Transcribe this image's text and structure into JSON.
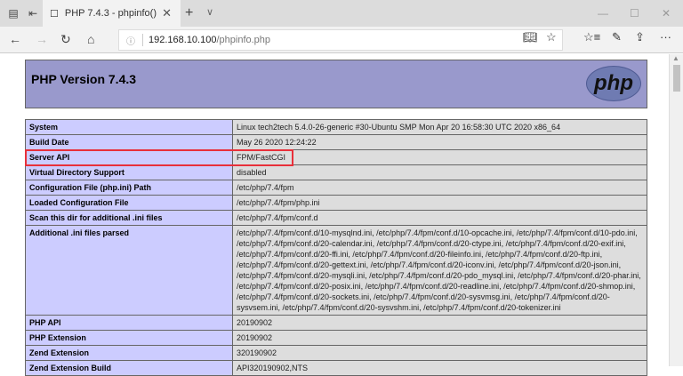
{
  "browser": {
    "tab_title": "PHP 7.4.3 - phpinfo()",
    "url_host": "192.168.10.100",
    "url_path": "/phpinfo.php",
    "icons": [
      "tab-set-aside-icon",
      "tab-preview-icon",
      "page-icon",
      "close-icon",
      "plus-icon",
      "chevron-down-icon",
      "minimize-icon",
      "maximize-icon",
      "window-close-icon",
      "back-icon",
      "forward-icon",
      "refresh-icon",
      "home-icon",
      "info-icon",
      "reading-view-icon",
      "star-icon",
      "favorites-icon",
      "pen-icon",
      "share-icon",
      "more-icon"
    ]
  },
  "page": {
    "title": "PHP Version 7.4.3",
    "logo_text": "php",
    "rows": [
      {
        "label": "System",
        "value": "Linux tech2tech 5.4.0-26-generic #30-Ubuntu SMP Mon Apr 20 16:58:30 UTC 2020 x86_64"
      },
      {
        "label": "Build Date",
        "value": "May 26 2020 12:24:22"
      },
      {
        "label": "Server API",
        "value": "FPM/FastCGI"
      },
      {
        "label": "Virtual Directory Support",
        "value": "disabled"
      },
      {
        "label": "Configuration File (php.ini) Path",
        "value": "/etc/php/7.4/fpm"
      },
      {
        "label": "Loaded Configuration File",
        "value": "/etc/php/7.4/fpm/php.ini"
      },
      {
        "label": "Scan this dir for additional .ini files",
        "value": "/etc/php/7.4/fpm/conf.d"
      },
      {
        "label": "Additional .ini files parsed",
        "value": "/etc/php/7.4/fpm/conf.d/10-mysqlnd.ini, /etc/php/7.4/fpm/conf.d/10-opcache.ini, /etc/php/7.4/fpm/conf.d/10-pdo.ini, /etc/php/7.4/fpm/conf.d/20-calendar.ini, /etc/php/7.4/fpm/conf.d/20-ctype.ini, /etc/php/7.4/fpm/conf.d/20-exif.ini, /etc/php/7.4/fpm/conf.d/20-ffi.ini, /etc/php/7.4/fpm/conf.d/20-fileinfo.ini, /etc/php/7.4/fpm/conf.d/20-ftp.ini, /etc/php/7.4/fpm/conf.d/20-gettext.ini, /etc/php/7.4/fpm/conf.d/20-iconv.ini, /etc/php/7.4/fpm/conf.d/20-json.ini, /etc/php/7.4/fpm/conf.d/20-mysqli.ini, /etc/php/7.4/fpm/conf.d/20-pdo_mysql.ini, /etc/php/7.4/fpm/conf.d/20-phar.ini, /etc/php/7.4/fpm/conf.d/20-posix.ini, /etc/php/7.4/fpm/conf.d/20-readline.ini, /etc/php/7.4/fpm/conf.d/20-shmop.ini, /etc/php/7.4/fpm/conf.d/20-sockets.ini, /etc/php/7.4/fpm/conf.d/20-sysvmsg.ini, /etc/php/7.4/fpm/conf.d/20-sysvsem.ini, /etc/php/7.4/fpm/conf.d/20-sysvshm.ini, /etc/php/7.4/fpm/conf.d/20-tokenizer.ini"
      },
      {
        "label": "PHP API",
        "value": "20190902"
      },
      {
        "label": "PHP Extension",
        "value": "20190902"
      },
      {
        "label": "Zend Extension",
        "value": "320190902"
      },
      {
        "label": "Zend Extension Build",
        "value": "API320190902,NTS"
      }
    ]
  },
  "colors": {
    "header": "#9999cc",
    "label_cell": "#ccccff",
    "value_cell": "#dddddd",
    "highlight": "#e8303a"
  }
}
